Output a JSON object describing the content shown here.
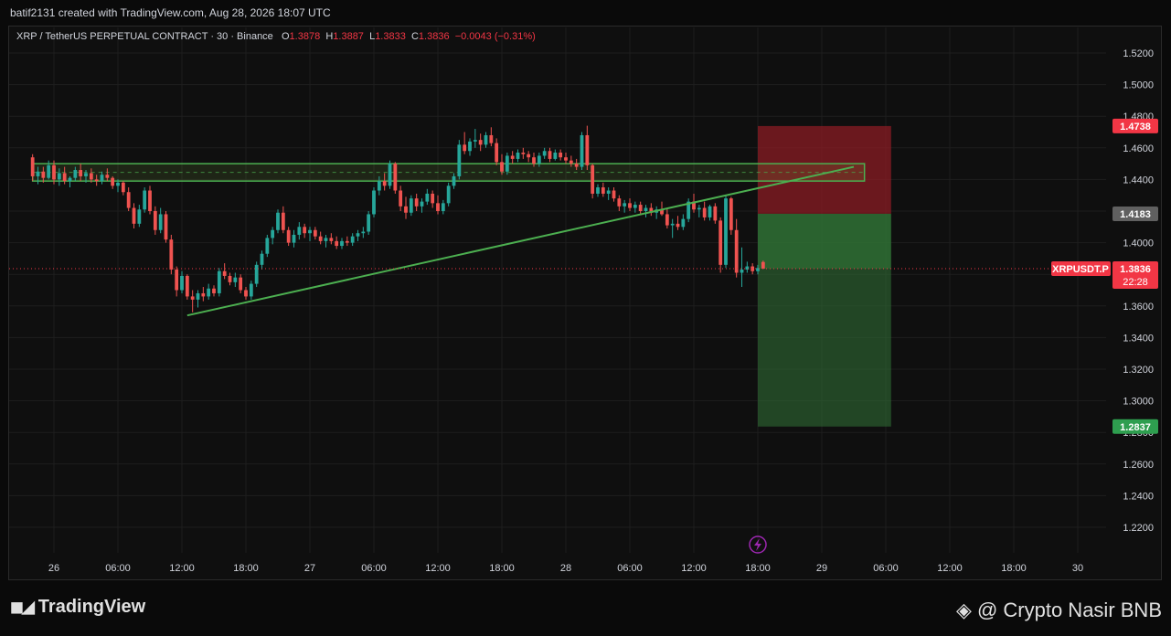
{
  "header": {
    "attribution": "batif2131 created with TradingView.com, Aug 28, 2026 18:07 UTC"
  },
  "legend": {
    "symbol": "XRP / TetherUS PERPETUAL CONTRACT · 30 · Binance",
    "o_label": "O",
    "o_value": "1.3878",
    "h_label": "H",
    "h_value": "1.3887",
    "l_label": "L",
    "l_value": "1.3833",
    "c_label": "C",
    "c_value": "1.3836",
    "change": "−0.0043 (−0.31%)"
  },
  "footer": {
    "brand": "TradingView",
    "signature": "@ Crypto Nasir BNB"
  },
  "colors": {
    "up": "#26a69a",
    "down": "#ef5350",
    "zone": "#4caf50",
    "stop_box": "#8b1c24",
    "target_box": "#2e6b33",
    "price_tag": "#f23645",
    "entry_tag": "#606060",
    "target_tag": "#2e9e4f"
  },
  "price_tags": {
    "stop": "1.4738",
    "entry": "1.4183",
    "current_symbol": "XRPUSDT.P",
    "current": "1.3836",
    "countdown": "22:28",
    "target": "1.2837"
  },
  "chart_data": {
    "type": "candlestick",
    "y_ticks": [
      "1.5200",
      "1.5000",
      "1.4800",
      "1.4600",
      "1.4400",
      "1.4200",
      "1.4000",
      "1.3800",
      "1.3600",
      "1.3400",
      "1.3200",
      "1.3000",
      "1.2800",
      "1.2600",
      "1.2400",
      "1.2200"
    ],
    "ylim": [
      1.2,
      1.53
    ],
    "x_ticks": [
      "26",
      "06:00",
      "12:00",
      "18:00",
      "27",
      "06:00",
      "12:00",
      "18:00",
      "28",
      "06:00",
      "12:00",
      "18:00",
      "29",
      "06:00",
      "12:00",
      "18:00",
      "30"
    ],
    "xlim_hours": [
      -2,
      104
    ],
    "candles_start_hour": -2,
    "candle_interval_hours": 0.5,
    "candles": [
      [
        1.454,
        1.456,
        1.439,
        1.442
      ],
      [
        1.442,
        1.448,
        1.437,
        1.445
      ],
      [
        1.445,
        1.448,
        1.438,
        1.441
      ],
      [
        1.441,
        1.452,
        1.44,
        1.449
      ],
      [
        1.449,
        1.452,
        1.437,
        1.44
      ],
      [
        1.44,
        1.447,
        1.436,
        1.444
      ],
      [
        1.444,
        1.448,
        1.437,
        1.439
      ],
      [
        1.439,
        1.442,
        1.435,
        1.441
      ],
      [
        1.441,
        1.448,
        1.439,
        1.446
      ],
      [
        1.446,
        1.45,
        1.439,
        1.442
      ],
      [
        1.442,
        1.446,
        1.438,
        1.444
      ],
      [
        1.444,
        1.447,
        1.438,
        1.44
      ],
      [
        1.44,
        1.443,
        1.436,
        1.439
      ],
      [
        1.439,
        1.445,
        1.437,
        1.443
      ],
      [
        1.443,
        1.447,
        1.439,
        1.441
      ],
      [
        1.441,
        1.442,
        1.434,
        1.436
      ],
      [
        1.436,
        1.44,
        1.432,
        1.438
      ],
      [
        1.438,
        1.439,
        1.43,
        1.432
      ],
      [
        1.432,
        1.435,
        1.42,
        1.422
      ],
      [
        1.422,
        1.425,
        1.409,
        1.412
      ],
      [
        1.412,
        1.424,
        1.41,
        1.421
      ],
      [
        1.421,
        1.435,
        1.419,
        1.433
      ],
      [
        1.433,
        1.436,
        1.418,
        1.42
      ],
      [
        1.42,
        1.423,
        1.405,
        1.408
      ],
      [
        1.408,
        1.422,
        1.406,
        1.418
      ],
      [
        1.418,
        1.42,
        1.4,
        1.402
      ],
      [
        1.402,
        1.405,
        1.38,
        1.383
      ],
      [
        1.383,
        1.385,
        1.366,
        1.37
      ],
      [
        1.37,
        1.382,
        1.368,
        1.379
      ],
      [
        1.379,
        1.38,
        1.364,
        1.366
      ],
      [
        1.366,
        1.37,
        1.356,
        1.364
      ],
      [
        1.364,
        1.37,
        1.359,
        1.368
      ],
      [
        1.368,
        1.372,
        1.363,
        1.366
      ],
      [
        1.366,
        1.374,
        1.364,
        1.371
      ],
      [
        1.371,
        1.373,
        1.366,
        1.368
      ],
      [
        1.368,
        1.384,
        1.366,
        1.382
      ],
      [
        1.382,
        1.387,
        1.377,
        1.379
      ],
      [
        1.379,
        1.381,
        1.373,
        1.375
      ],
      [
        1.375,
        1.381,
        1.372,
        1.378
      ],
      [
        1.378,
        1.38,
        1.368,
        1.37
      ],
      [
        1.37,
        1.372,
        1.364,
        1.366
      ],
      [
        1.366,
        1.376,
        1.364,
        1.374
      ],
      [
        1.374,
        1.388,
        1.372,
        1.386
      ],
      [
        1.386,
        1.395,
        1.383,
        1.393
      ],
      [
        1.393,
        1.405,
        1.391,
        1.403
      ],
      [
        1.403,
        1.41,
        1.399,
        1.408
      ],
      [
        1.408,
        1.421,
        1.406,
        1.419
      ],
      [
        1.419,
        1.423,
        1.406,
        1.408
      ],
      [
        1.408,
        1.41,
        1.398,
        1.4
      ],
      [
        1.4,
        1.408,
        1.397,
        1.405
      ],
      [
        1.405,
        1.413,
        1.402,
        1.41
      ],
      [
        1.41,
        1.412,
        1.403,
        1.406
      ],
      [
        1.406,
        1.41,
        1.401,
        1.408
      ],
      [
        1.408,
        1.41,
        1.402,
        1.404
      ],
      [
        1.404,
        1.407,
        1.399,
        1.401
      ],
      [
        1.401,
        1.405,
        1.397,
        1.403
      ],
      [
        1.403,
        1.406,
        1.399,
        1.401
      ],
      [
        1.401,
        1.404,
        1.396,
        1.398
      ],
      [
        1.398,
        1.403,
        1.396,
        1.401
      ],
      [
        1.401,
        1.404,
        1.398,
        1.4
      ],
      [
        1.4,
        1.406,
        1.398,
        1.404
      ],
      [
        1.404,
        1.408,
        1.401,
        1.406
      ],
      [
        1.406,
        1.41,
        1.403,
        1.407
      ],
      [
        1.407,
        1.42,
        1.405,
        1.418
      ],
      [
        1.418,
        1.435,
        1.416,
        1.433
      ],
      [
        1.433,
        1.442,
        1.43,
        1.439
      ],
      [
        1.439,
        1.444,
        1.433,
        1.436
      ],
      [
        1.436,
        1.452,
        1.434,
        1.45
      ],
      [
        1.45,
        1.451,
        1.431,
        1.433
      ],
      [
        1.433,
        1.436,
        1.42,
        1.423
      ],
      [
        1.423,
        1.429,
        1.415,
        1.419
      ],
      [
        1.419,
        1.43,
        1.417,
        1.428
      ],
      [
        1.428,
        1.431,
        1.42,
        1.423
      ],
      [
        1.423,
        1.428,
        1.419,
        1.426
      ],
      [
        1.426,
        1.434,
        1.424,
        1.431
      ],
      [
        1.431,
        1.433,
        1.422,
        1.425
      ],
      [
        1.425,
        1.43,
        1.418,
        1.42
      ],
      [
        1.42,
        1.427,
        1.418,
        1.425
      ],
      [
        1.425,
        1.438,
        1.423,
        1.436
      ],
      [
        1.436,
        1.444,
        1.434,
        1.442
      ],
      [
        1.442,
        1.465,
        1.44,
        1.462
      ],
      [
        1.462,
        1.47,
        1.456,
        1.458
      ],
      [
        1.458,
        1.466,
        1.455,
        1.464
      ],
      [
        1.464,
        1.472,
        1.46,
        1.465
      ],
      [
        1.465,
        1.469,
        1.458,
        1.462
      ],
      [
        1.462,
        1.47,
        1.46,
        1.468
      ],
      [
        1.468,
        1.473,
        1.461,
        1.463
      ],
      [
        1.463,
        1.466,
        1.449,
        1.451
      ],
      [
        1.451,
        1.456,
        1.443,
        1.445
      ],
      [
        1.445,
        1.457,
        1.443,
        1.455
      ],
      [
        1.455,
        1.458,
        1.45,
        1.453
      ],
      [
        1.453,
        1.459,
        1.451,
        1.457
      ],
      [
        1.457,
        1.46,
        1.453,
        1.456
      ],
      [
        1.456,
        1.458,
        1.451,
        1.454
      ],
      [
        1.454,
        1.457,
        1.448,
        1.45
      ],
      [
        1.45,
        1.457,
        1.448,
        1.455
      ],
      [
        1.455,
        1.46,
        1.453,
        1.458
      ],
      [
        1.458,
        1.46,
        1.451,
        1.453
      ],
      [
        1.453,
        1.459,
        1.452,
        1.457
      ],
      [
        1.457,
        1.459,
        1.452,
        1.454
      ],
      [
        1.454,
        1.457,
        1.45,
        1.452
      ],
      [
        1.452,
        1.455,
        1.448,
        1.45
      ],
      [
        1.45,
        1.453,
        1.446,
        1.448
      ],
      [
        1.448,
        1.47,
        1.446,
        1.468
      ],
      [
        1.468,
        1.474,
        1.446,
        1.449
      ],
      [
        1.449,
        1.45,
        1.428,
        1.431
      ],
      [
        1.431,
        1.437,
        1.429,
        1.435
      ],
      [
        1.435,
        1.438,
        1.429,
        1.431
      ],
      [
        1.431,
        1.435,
        1.427,
        1.433
      ],
      [
        1.433,
        1.435,
        1.426,
        1.428
      ],
      [
        1.428,
        1.43,
        1.42,
        1.423
      ],
      [
        1.423,
        1.427,
        1.419,
        1.425
      ],
      [
        1.425,
        1.428,
        1.42,
        1.422
      ],
      [
        1.422,
        1.426,
        1.419,
        1.424
      ],
      [
        1.424,
        1.426,
        1.418,
        1.42
      ],
      [
        1.42,
        1.424,
        1.416,
        1.422
      ],
      [
        1.422,
        1.425,
        1.417,
        1.419
      ],
      [
        1.419,
        1.423,
        1.415,
        1.421
      ],
      [
        1.421,
        1.426,
        1.417,
        1.418
      ],
      [
        1.418,
        1.422,
        1.409,
        1.411
      ],
      [
        1.411,
        1.415,
        1.403,
        1.412
      ],
      [
        1.412,
        1.417,
        1.408,
        1.41
      ],
      [
        1.41,
        1.418,
        1.408,
        1.415
      ],
      [
        1.415,
        1.428,
        1.413,
        1.426
      ],
      [
        1.426,
        1.431,
        1.419,
        1.421
      ],
      [
        1.421,
        1.424,
        1.416,
        1.422
      ],
      [
        1.422,
        1.426,
        1.414,
        1.416
      ],
      [
        1.416,
        1.424,
        1.414,
        1.423
      ],
      [
        1.423,
        1.425,
        1.412,
        1.414
      ],
      [
        1.414,
        1.416,
        1.381,
        1.386
      ],
      [
        1.386,
        1.43,
        1.384,
        1.428
      ],
      [
        1.428,
        1.429,
        1.405,
        1.408
      ],
      [
        1.408,
        1.415,
        1.378,
        1.381
      ],
      [
        1.381,
        1.397,
        1.372,
        1.383
      ],
      [
        1.383,
        1.388,
        1.381,
        1.385
      ],
      [
        1.385,
        1.387,
        1.38,
        1.382
      ],
      [
        1.382,
        1.386,
        1.38,
        1.384
      ],
      [
        1.3878,
        1.3887,
        1.3833,
        1.3836
      ]
    ],
    "zone": {
      "top": 1.45,
      "bottom": 1.439,
      "from_hour": -2,
      "to_hour": 76,
      "mid": 1.4445
    },
    "trendline": {
      "from": [
        12.5,
        1.354
      ],
      "to": [
        75,
        1.448
      ]
    },
    "position": {
      "from_hour": 66,
      "to_hour": 78.5,
      "stop": 1.4738,
      "entry": 1.4183,
      "target": 1.2837,
      "current": 1.3836
    }
  }
}
